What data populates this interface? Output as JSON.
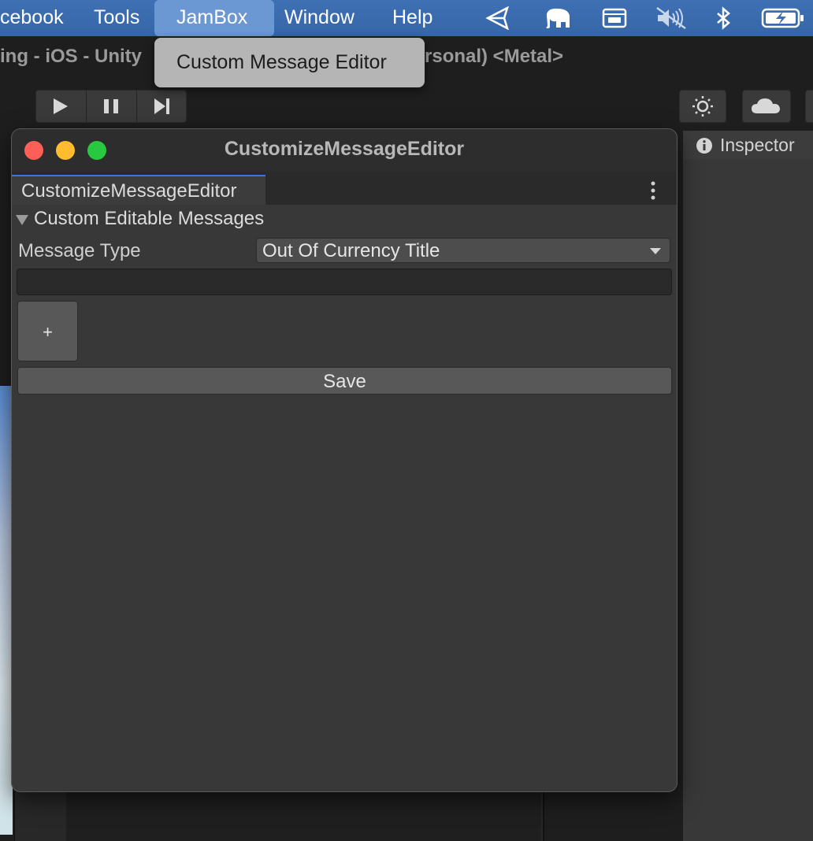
{
  "menubar": {
    "items": [
      {
        "label": "cebook"
      },
      {
        "label": "Tools"
      },
      {
        "label": "JamBox"
      },
      {
        "label": "Window"
      },
      {
        "label": "Help"
      }
    ],
    "active_index": 2,
    "icons": [
      "unity-icon",
      "elephant-icon",
      "keyboard-window-icon",
      "volume-muted-icon",
      "bluetooth-icon",
      "battery-charging-icon"
    ]
  },
  "dropdown": {
    "items": [
      {
        "label": "Custom Message Editor"
      }
    ]
  },
  "unity": {
    "title_left": "ing - iOS - Unity",
    "title_right": "rsonal) <Metal>",
    "inspector_tab": "Inspector"
  },
  "window": {
    "title": "CustomizeMessageEditor",
    "tab_label": "CustomizeMessageEditor",
    "foldout_label": "Custom Editable Messages",
    "message_type_label": "Message Type",
    "message_type_value": "Out Of Currency Title",
    "text_value": "",
    "plus_label": "+",
    "save_label": "Save"
  },
  "colors": {
    "menubar": "#3f70b3",
    "window_bg": "#383838",
    "tab_accent": "#3c78d8",
    "traffic_close": "#ff5f57",
    "traffic_min": "#febc2e",
    "traffic_max": "#28c840"
  }
}
